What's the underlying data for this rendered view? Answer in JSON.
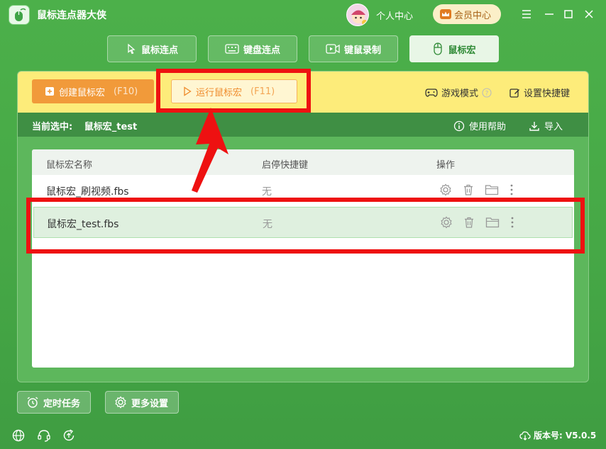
{
  "app": {
    "title": "鼠标连点器大侠",
    "personal_center": "个人中心",
    "vip_center": "会员中心"
  },
  "nav": [
    {
      "label": "鼠标连点",
      "icon": "cursor-icon"
    },
    {
      "label": "键盘连点",
      "icon": "keyboard-icon"
    },
    {
      "label": "键鼠录制",
      "icon": "video-record-icon"
    },
    {
      "label": "鼠标宏",
      "icon": "mouse-icon"
    }
  ],
  "toolbar": {
    "create_label": "创建鼠标宏",
    "create_hint": "(F10)",
    "run_label": "运行鼠标宏",
    "run_hint": "(F11)",
    "game_mode": "游戏模式",
    "set_hotkey": "设置快捷键"
  },
  "status": {
    "current_label": "当前选中:",
    "current_value": "鼠标宏_test",
    "help": "使用帮助",
    "import": "导入"
  },
  "table": {
    "headers": [
      "鼠标宏名称",
      "启停快捷键",
      "操作"
    ],
    "rows": [
      {
        "name": "鼠标宏_刷视频.fbs",
        "hotkey": "无"
      },
      {
        "name": "鼠标宏_test.fbs",
        "hotkey": "无"
      }
    ]
  },
  "bottom": {
    "timer": "定时任务",
    "more_settings": "更多设置"
  },
  "footer": {
    "version_label": "版本号:",
    "version_value": "V5.0.5"
  },
  "colors": {
    "green": "#46a846",
    "toolbar_yellow": "#fdec7a",
    "orange": "#f19a3a",
    "annotation_red": "#ee1111"
  }
}
